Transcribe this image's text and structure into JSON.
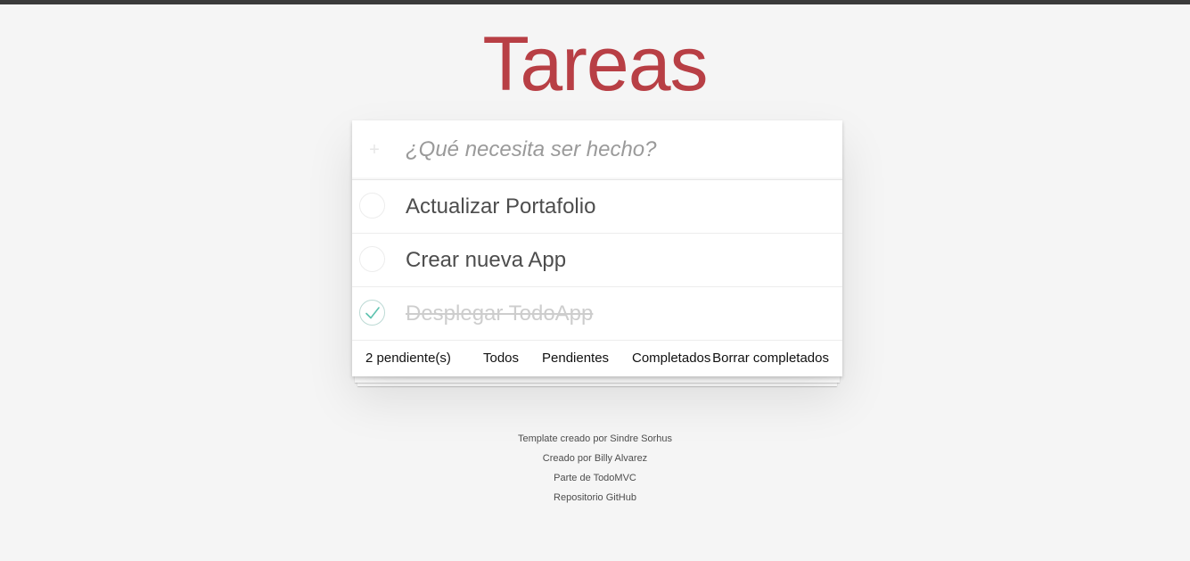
{
  "header": {
    "title": "Tareas"
  },
  "new_todo": {
    "placeholder": "¿Qué necesita ser hecho?",
    "icon": "plus-icon"
  },
  "todos": [
    {
      "label": "Actualizar Portafolio",
      "completed": false
    },
    {
      "label": "Crear nueva App",
      "completed": false
    },
    {
      "label": "Desplegar TodoApp",
      "completed": true
    }
  ],
  "footer": {
    "count": "2 pendiente(s)",
    "filters": [
      "Todos",
      "Pendientes",
      "Completados"
    ],
    "clear": "Borrar completados"
  },
  "info": [
    "Template creado por Sindre Sorhus",
    "Creado por Billy Alvarez",
    "Parte de TodoMVC",
    "Repositorio GitHub"
  ],
  "colors": {
    "title": "#b83f45",
    "background": "#f5f5f5",
    "check": "#5dc2af"
  }
}
